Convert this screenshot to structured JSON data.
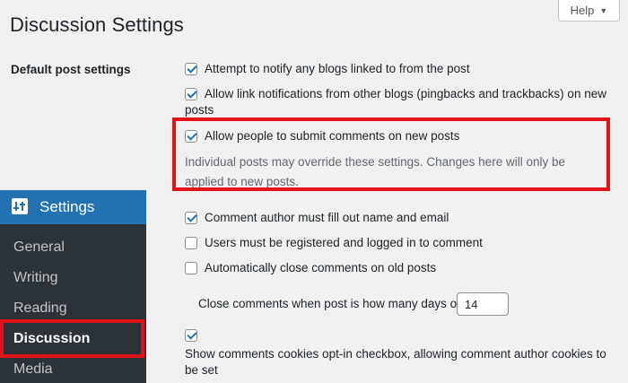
{
  "page": {
    "title": "Discussion Settings",
    "help_label": "Help",
    "help_caret": "▼"
  },
  "section": {
    "label": "Default post settings"
  },
  "options": {
    "notify_blogs": {
      "label": "Attempt to notify any blogs linked to from the post",
      "checked": true
    },
    "allow_pingbacks": {
      "label_line1": "Allow link notifications from other blogs (pingbacks and trackbacks) on new",
      "label_line2": "posts",
      "checked": true
    },
    "allow_comments": {
      "label": "Allow people to submit comments on new posts",
      "checked": true
    },
    "override_note": "Individual posts may override these settings. Changes here will only be applied to new posts.",
    "author_name_email": {
      "label": "Comment author must fill out name and email",
      "checked": true
    },
    "registered_only": {
      "label": "Users must be registered and logged in to comment",
      "checked": false
    },
    "auto_close": {
      "label": "Automatically close comments on old posts",
      "checked": false
    },
    "close_days": {
      "label": "Close comments when post is how many days old",
      "value": "14"
    },
    "cookies_optin": {
      "label": "Show comments cookies opt-in checkbox, allowing comment author cookies to be set",
      "checked": true
    }
  },
  "sidebar": {
    "title": "Settings",
    "items": [
      {
        "label": "General"
      },
      {
        "label": "Writing"
      },
      {
        "label": "Reading"
      },
      {
        "label": "Discussion"
      },
      {
        "label": "Media"
      }
    ]
  },
  "colors": {
    "highlight": "#e0141a",
    "accent": "#2271b1",
    "sidebar_bg": "#2c3338"
  }
}
